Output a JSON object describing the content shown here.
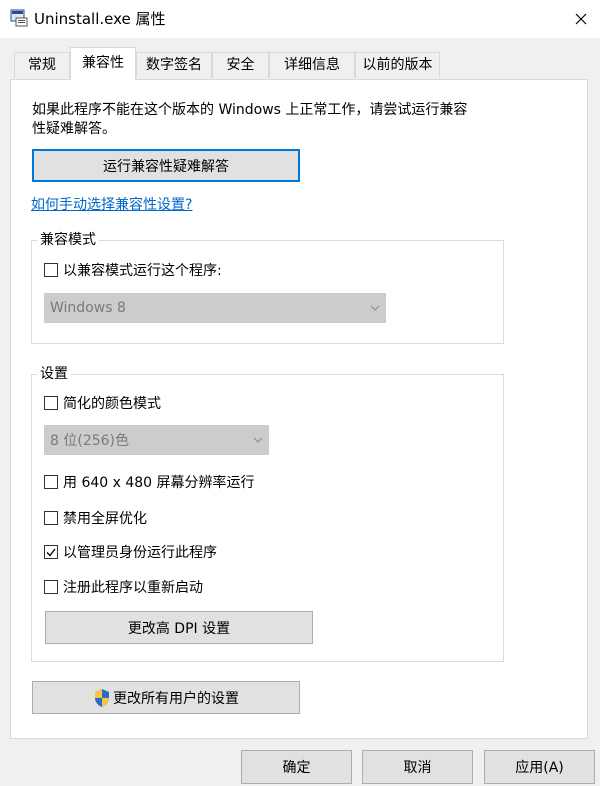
{
  "window": {
    "title": "Uninstall.exe 属性"
  },
  "tabs": [
    {
      "label": "常规"
    },
    {
      "label": "兼容性"
    },
    {
      "label": "数字签名"
    },
    {
      "label": "安全"
    },
    {
      "label": "详细信息"
    },
    {
      "label": "以前的版本"
    }
  ],
  "intro": {
    "line1": "如果此程序不能在这个版本的 Windows 上正常工作，请尝试运行兼容",
    "line2": "性疑难解答。"
  },
  "troubleshooter_button": "运行兼容性疑难解答",
  "manual_link": "如何手动选择兼容性设置?",
  "compat_mode": {
    "group_label": "兼容模式",
    "checkbox_label": "以兼容模式运行这个程序:",
    "checked": false,
    "os_select_value": "Windows 8"
  },
  "settings": {
    "group_label": "设置",
    "reduced_color": {
      "label": "简化的颜色模式",
      "checked": false
    },
    "color_select_value": "8 位(256)色",
    "res_640": {
      "label": "用 640 x 480 屏幕分辨率运行",
      "checked": false
    },
    "disable_fullscreen": {
      "label": "禁用全屏优化",
      "checked": false
    },
    "run_as_admin": {
      "label": "以管理员身份运行此程序",
      "checked": true
    },
    "register_restart": {
      "label": "注册此程序以重新启动",
      "checked": false
    },
    "high_dpi_button": "更改高 DPI 设置"
  },
  "all_users_button": "更改所有用户的设置",
  "footer": {
    "ok": "确定",
    "cancel": "取消",
    "apply": "应用(A)"
  }
}
